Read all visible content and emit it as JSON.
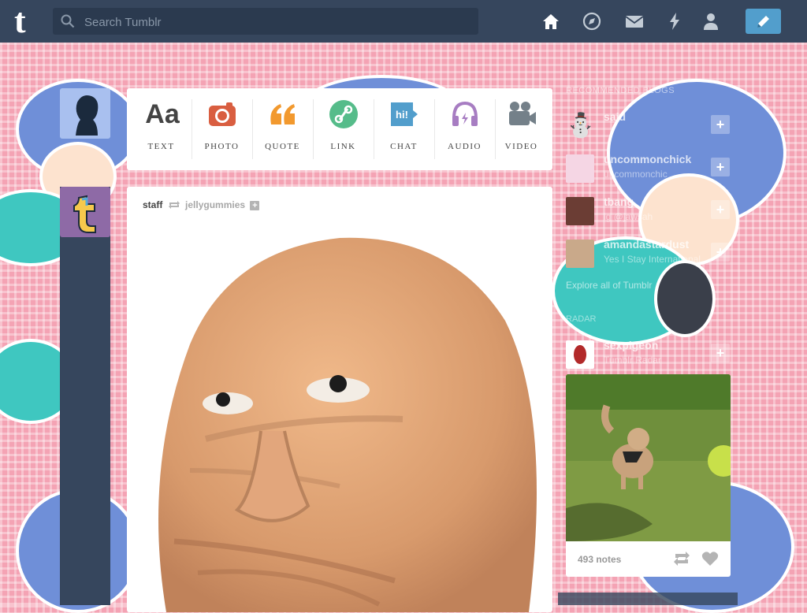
{
  "header": {
    "logo_glyph": "t",
    "search": {
      "placeholder": "Search Tumblr"
    },
    "nav_icons": [
      "home-icon",
      "explore-icon",
      "inbox-icon",
      "activity-icon",
      "account-icon"
    ],
    "compose_icon": "pencil-icon"
  },
  "post_types": [
    {
      "label": "TEXT",
      "icon": "text-icon",
      "color": "#444444"
    },
    {
      "label": "PHOTO",
      "icon": "camera-icon",
      "color": "#d95e40"
    },
    {
      "label": "QUOTE",
      "icon": "quote-icon",
      "color": "#f2992e"
    },
    {
      "label": "LINK",
      "icon": "link-icon",
      "color": "#56bc8a"
    },
    {
      "label": "CHAT",
      "icon": "chat-icon",
      "color": "#529ecc"
    },
    {
      "label": "AUDIO",
      "icon": "headphones-icon",
      "color": "#a77dc2"
    },
    {
      "label": "VIDEO",
      "icon": "video-camera-icon",
      "color": "#748089"
    }
  ],
  "post": {
    "author": "staff",
    "reblogged_from": "jellygummies"
  },
  "sidebar": {
    "title": "RECOMMENDED BLOGS",
    "blogs": [
      {
        "name": "said",
        "subtitle": ""
      },
      {
        "name": "uncommonchick",
        "subtitle": "uncommonchic"
      },
      {
        "name": "tbang",
        "subtitle": "ig @jawsah"
      },
      {
        "name": "amandastardust",
        "subtitle": "Yes I Stay International"
      }
    ],
    "explore": "Explore all of Tumblr",
    "radar": {
      "title": "RADAR",
      "blog_name": "sexpigeon",
      "blog_subtitle": "Tumblr Radar",
      "notes": "493 notes"
    }
  },
  "colors": {
    "header": "#36465d",
    "accent": "#529ecc",
    "background": "#f4a3b4"
  }
}
